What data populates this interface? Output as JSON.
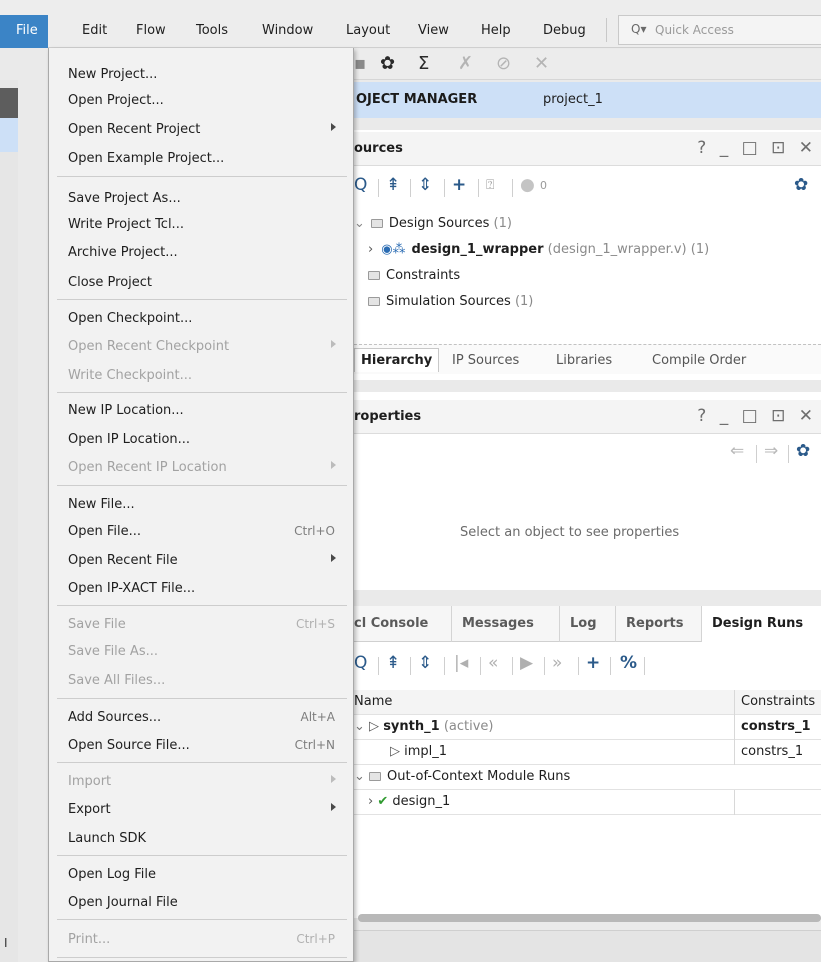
{
  "menubar": {
    "items": [
      "File",
      "Edit",
      "Flow",
      "Tools",
      "Window",
      "Layout",
      "View",
      "Help",
      "Debug"
    ],
    "quick_access_placeholder": "Quick Access",
    "search_icon": "search-icon"
  },
  "toolbar": {
    "icons": [
      "gear-icon",
      "sigma-icon",
      "cross-disabled-icon",
      "slash-disabled-icon",
      "x-disabled-icon"
    ]
  },
  "project_manager": {
    "title": "OJECT MANAGER",
    "project": "project_1"
  },
  "sources_panel": {
    "title": "ources",
    "controls": "? _ □ ⊡ ✕",
    "badge_count": "0",
    "tree": [
      {
        "label": "Design Sources",
        "suffix": "(1)"
      },
      {
        "label": "design_1_wrapper",
        "detail": "(design_1_wrapper.v) (1)"
      },
      {
        "label": "Constraints"
      },
      {
        "label": "Simulation Sources",
        "suffix": "(1)"
      }
    ],
    "tabs": [
      "Hierarchy",
      "IP Sources",
      "Libraries",
      "Compile Order"
    ]
  },
  "properties_panel": {
    "title": "roperties",
    "controls": "? _ □ ⊡ ✕",
    "placeholder": "Select an object to see properties"
  },
  "bottom_panel": {
    "tabs": [
      "cl Console",
      "Messages",
      "Log",
      "Reports",
      "Design Runs"
    ],
    "columns": [
      "Name",
      "Constraints"
    ],
    "rows": [
      {
        "name": "synth_1",
        "status": "(active)",
        "constraints": "constrs_1"
      },
      {
        "name": "impl_1",
        "constraints": "constrs_1"
      },
      {
        "name": "Out-of-Context Module Runs",
        "constraints": ""
      },
      {
        "name": "design_1",
        "constraints": ""
      }
    ]
  },
  "file_menu": {
    "items": [
      {
        "label": "New Project...",
        "shortcut": "",
        "submenu": false,
        "disabled": false
      },
      {
        "label": "Open Project...",
        "shortcut": "",
        "submenu": false,
        "disabled": false
      },
      {
        "label": "Open Recent Project",
        "shortcut": "",
        "submenu": true,
        "disabled": false
      },
      {
        "label": "Open Example Project...",
        "shortcut": "",
        "submenu": false,
        "disabled": false
      },
      {
        "label": "Save Project As...",
        "shortcut": "",
        "submenu": false,
        "disabled": false
      },
      {
        "label": "Write Project Tcl...",
        "shortcut": "",
        "submenu": false,
        "disabled": false
      },
      {
        "label": "Archive Project...",
        "shortcut": "",
        "submenu": false,
        "disabled": false
      },
      {
        "label": "Close Project",
        "shortcut": "",
        "submenu": false,
        "disabled": false
      },
      {
        "label": "Open Checkpoint...",
        "shortcut": "",
        "submenu": false,
        "disabled": false
      },
      {
        "label": "Open Recent Checkpoint",
        "shortcut": "",
        "submenu": true,
        "disabled": true
      },
      {
        "label": "Write Checkpoint...",
        "shortcut": "",
        "submenu": false,
        "disabled": true
      },
      {
        "label": "New IP Location...",
        "shortcut": "",
        "submenu": false,
        "disabled": false
      },
      {
        "label": "Open IP Location...",
        "shortcut": "",
        "submenu": false,
        "disabled": false
      },
      {
        "label": "Open Recent IP Location",
        "shortcut": "",
        "submenu": true,
        "disabled": true
      },
      {
        "label": "New File...",
        "shortcut": "",
        "submenu": false,
        "disabled": false
      },
      {
        "label": "Open File...",
        "shortcut": "Ctrl+O",
        "submenu": false,
        "disabled": false
      },
      {
        "label": "Open Recent File",
        "shortcut": "",
        "submenu": true,
        "disabled": false
      },
      {
        "label": "Open IP-XACT File...",
        "shortcut": "",
        "submenu": false,
        "disabled": false
      },
      {
        "label": "Save File",
        "shortcut": "Ctrl+S",
        "submenu": false,
        "disabled": true
      },
      {
        "label": "Save File As...",
        "shortcut": "",
        "submenu": false,
        "disabled": true
      },
      {
        "label": "Save All Files...",
        "shortcut": "",
        "submenu": false,
        "disabled": true
      },
      {
        "label": "Add Sources...",
        "shortcut": "Alt+A",
        "submenu": false,
        "disabled": false
      },
      {
        "label": "Open Source File...",
        "shortcut": "Ctrl+N",
        "submenu": false,
        "disabled": false
      },
      {
        "label": "Import",
        "shortcut": "",
        "submenu": true,
        "disabled": true
      },
      {
        "label": "Export",
        "shortcut": "",
        "submenu": true,
        "disabled": false
      },
      {
        "label": "Launch SDK",
        "shortcut": "",
        "submenu": false,
        "disabled": false
      },
      {
        "label": "Open Log File",
        "shortcut": "",
        "submenu": false,
        "disabled": false
      },
      {
        "label": "Open Journal File",
        "shortcut": "",
        "submenu": false,
        "disabled": false
      },
      {
        "label": "Print...",
        "shortcut": "Ctrl+P",
        "submenu": false,
        "disabled": true
      }
    ]
  },
  "left_edge_text": "I"
}
